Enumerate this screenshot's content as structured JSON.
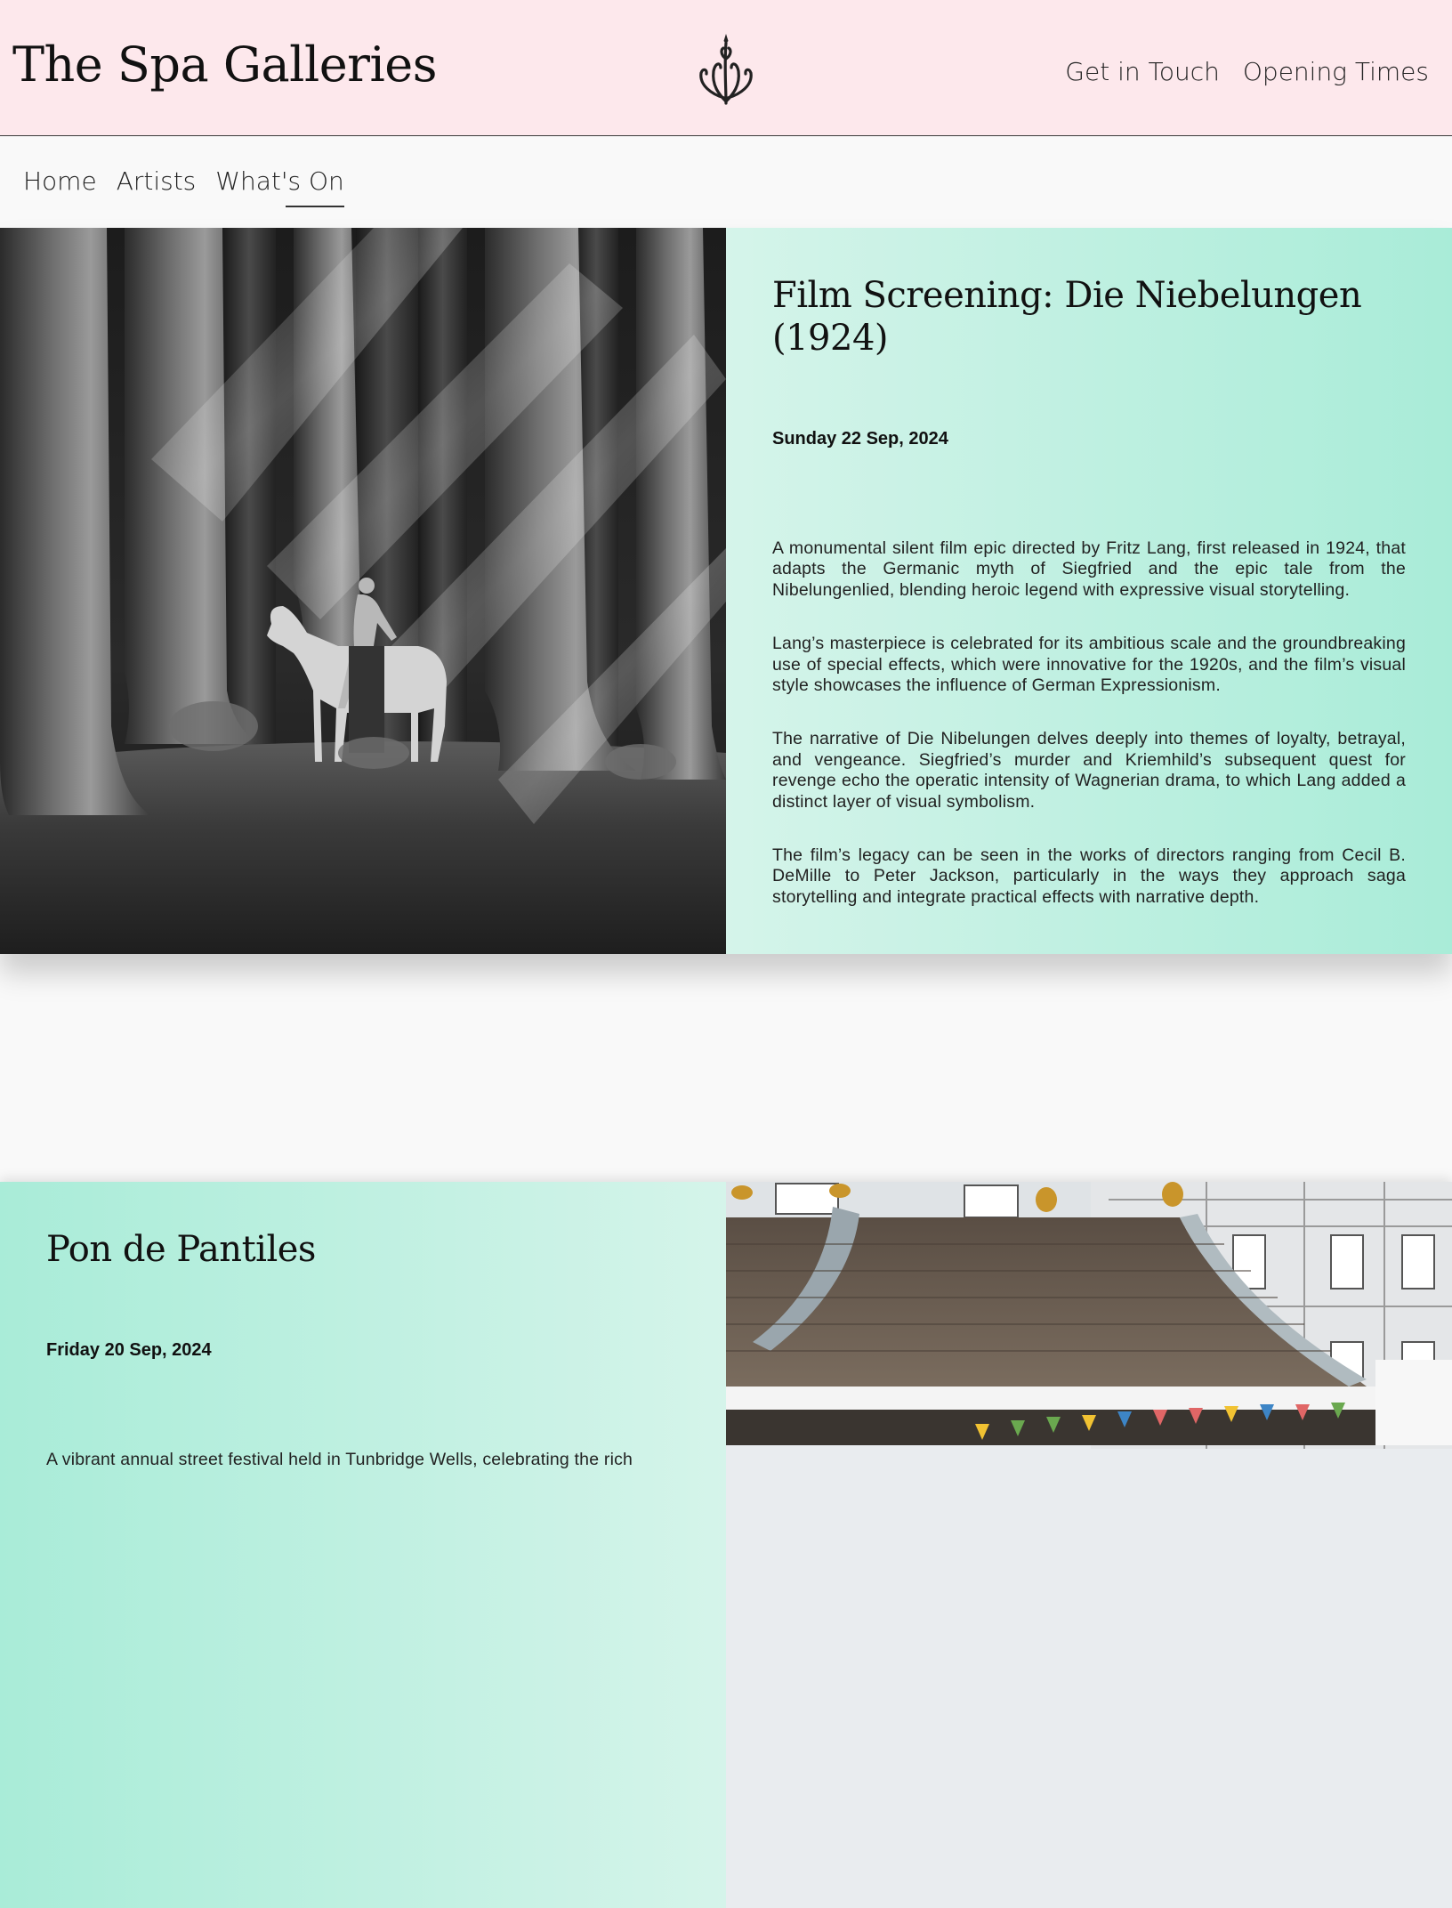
{
  "site": {
    "title": "The Spa Galleries",
    "logo_icon": "fountain-icon"
  },
  "header_links": {
    "contact": "Get in Touch",
    "opening": "Opening Times"
  },
  "nav": {
    "items": [
      {
        "label": "Home"
      },
      {
        "label": "Artists"
      },
      {
        "label": "What's On",
        "active": true
      }
    ]
  },
  "events": [
    {
      "title": "Film Screening: Die Niebelungen (1924)",
      "date": "Sunday 22 Sep, 2024",
      "image": "forest-horse-rider-photo",
      "paragraphs": [
        "A monumental silent film epic directed by Fritz Lang, first released in 1924, that adapts the Germanic myth of Siegfried and the epic tale from the Nibelungenlied, blending heroic legend with expressive visual storytelling.",
        "Lang’s masterpiece is celebrated for its ambitious scale and the groundbreaking use of special effects, which were innovative for the 1920s, and the film’s visual style showcases the influence of German Expressionism.",
        "The narrative of Die Nibelungen delves deeply into themes of loyalty, betrayal, and vengeance. Siegfried’s murder and Kriemhild’s subsequent quest for revenge echo the operatic intensity of Wagnerian drama, to which Lang added a distinct layer of visual symbolism.",
        "The film’s legacy can be seen in the works of directors ranging from Cecil B. DeMille to Peter Jackson, particularly in the ways they approach saga storytelling and integrate practical effects with narrative depth."
      ]
    },
    {
      "title": "Pon de Pantiles",
      "date": "Friday 20 Sep, 2024",
      "image": "pantiles-bandstand-photo",
      "paragraphs": [
        "A vibrant annual street festival held in Tunbridge Wells, celebrating the rich"
      ]
    }
  ],
  "colors": {
    "header_bg": "#fde8ec",
    "page_bg": "#f9f9f9",
    "mint_light": "#d5f4ea",
    "mint": "#a9ecd8"
  }
}
